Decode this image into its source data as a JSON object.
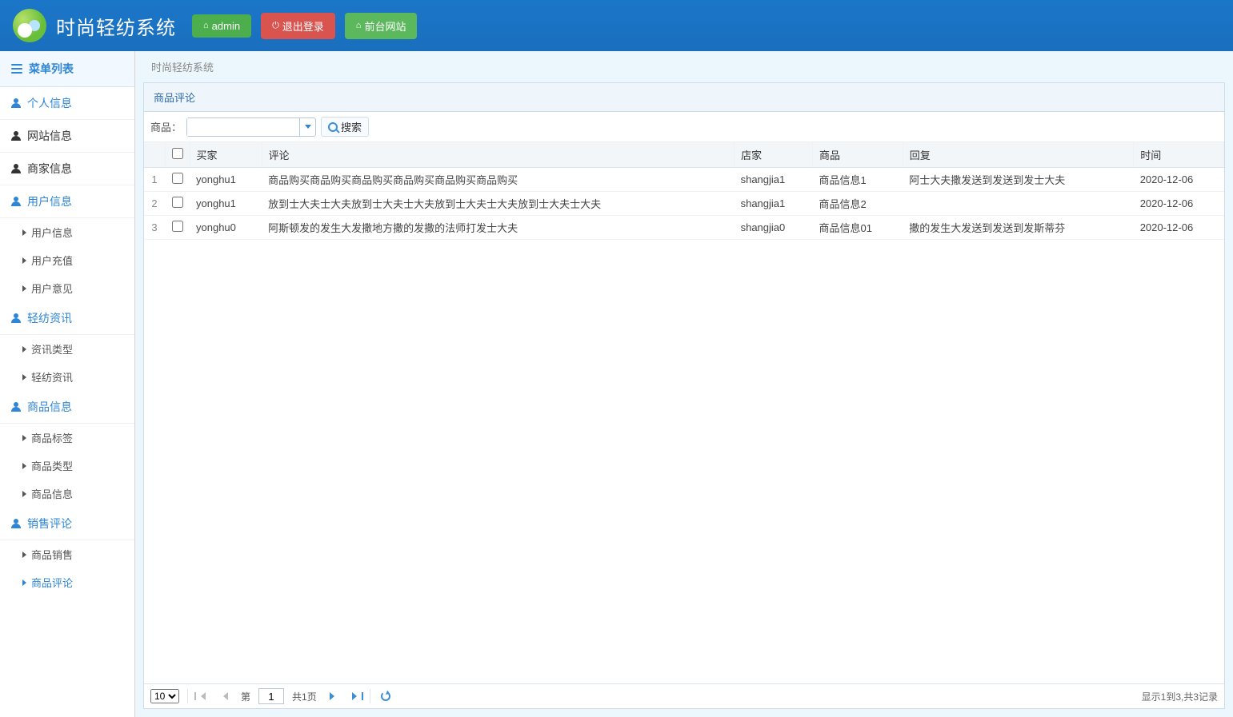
{
  "header": {
    "app_title": "时尚轻纺系统",
    "admin_btn": "admin",
    "logout_btn": "退出登录",
    "front_btn": "前台网站"
  },
  "sidebar": {
    "menu_head": "菜单列表",
    "groups": [
      {
        "label": "个人信息",
        "expanded": true,
        "items": []
      },
      {
        "label": "网站信息",
        "expanded": false,
        "items": []
      },
      {
        "label": "商家信息",
        "expanded": false,
        "items": []
      },
      {
        "label": "用户信息",
        "expanded": true,
        "items": [
          {
            "label": "用户信息"
          },
          {
            "label": "用户充值"
          },
          {
            "label": "用户意见"
          }
        ]
      },
      {
        "label": "轻纺资讯",
        "expanded": true,
        "items": [
          {
            "label": "资讯类型"
          },
          {
            "label": "轻纺资讯"
          }
        ]
      },
      {
        "label": "商品信息",
        "expanded": true,
        "items": [
          {
            "label": "商品标签"
          },
          {
            "label": "商品类型"
          },
          {
            "label": "商品信息"
          }
        ]
      },
      {
        "label": "销售评论",
        "expanded": true,
        "items": [
          {
            "label": "商品销售"
          },
          {
            "label": "商品评论",
            "active": true
          }
        ]
      }
    ]
  },
  "breadcrumb": "时尚轻纺系统",
  "panel": {
    "title": "商品评论",
    "search_label": "商品：",
    "search_btn": "搜索",
    "columns": [
      "",
      "",
      "买家",
      "评论",
      "店家",
      "商品",
      "回复",
      "时间"
    ],
    "rows": [
      {
        "n": "1",
        "buyer": "yonghu1",
        "comment": "商品购买商品购买商品购买商品购买商品购买商品购买",
        "shop": "shangjia1",
        "product": "商品信息1",
        "reply": "阿士大夫撒发送到发送到发士大夫",
        "time": "2020-12-06"
      },
      {
        "n": "2",
        "buyer": "yonghu1",
        "comment": "放到士大夫士大夫放到士大夫士大夫放到士大夫士大夫放到士大夫士大夫",
        "shop": "shangjia1",
        "product": "商品信息2",
        "reply": "",
        "time": "2020-12-06"
      },
      {
        "n": "3",
        "buyer": "yonghu0",
        "comment": "阿斯顿发的发生大发撒地方撒的发撒的法师打发士大夫",
        "shop": "shangjia0",
        "product": "商品信息01",
        "reply": "撒的发生大发送到发送到发斯蒂芬",
        "time": "2020-12-06"
      }
    ]
  },
  "pager": {
    "page_size": "10",
    "page_label_pre": "第",
    "page_value": "1",
    "page_total": "共1页",
    "info": "显示1到3,共3记录"
  }
}
